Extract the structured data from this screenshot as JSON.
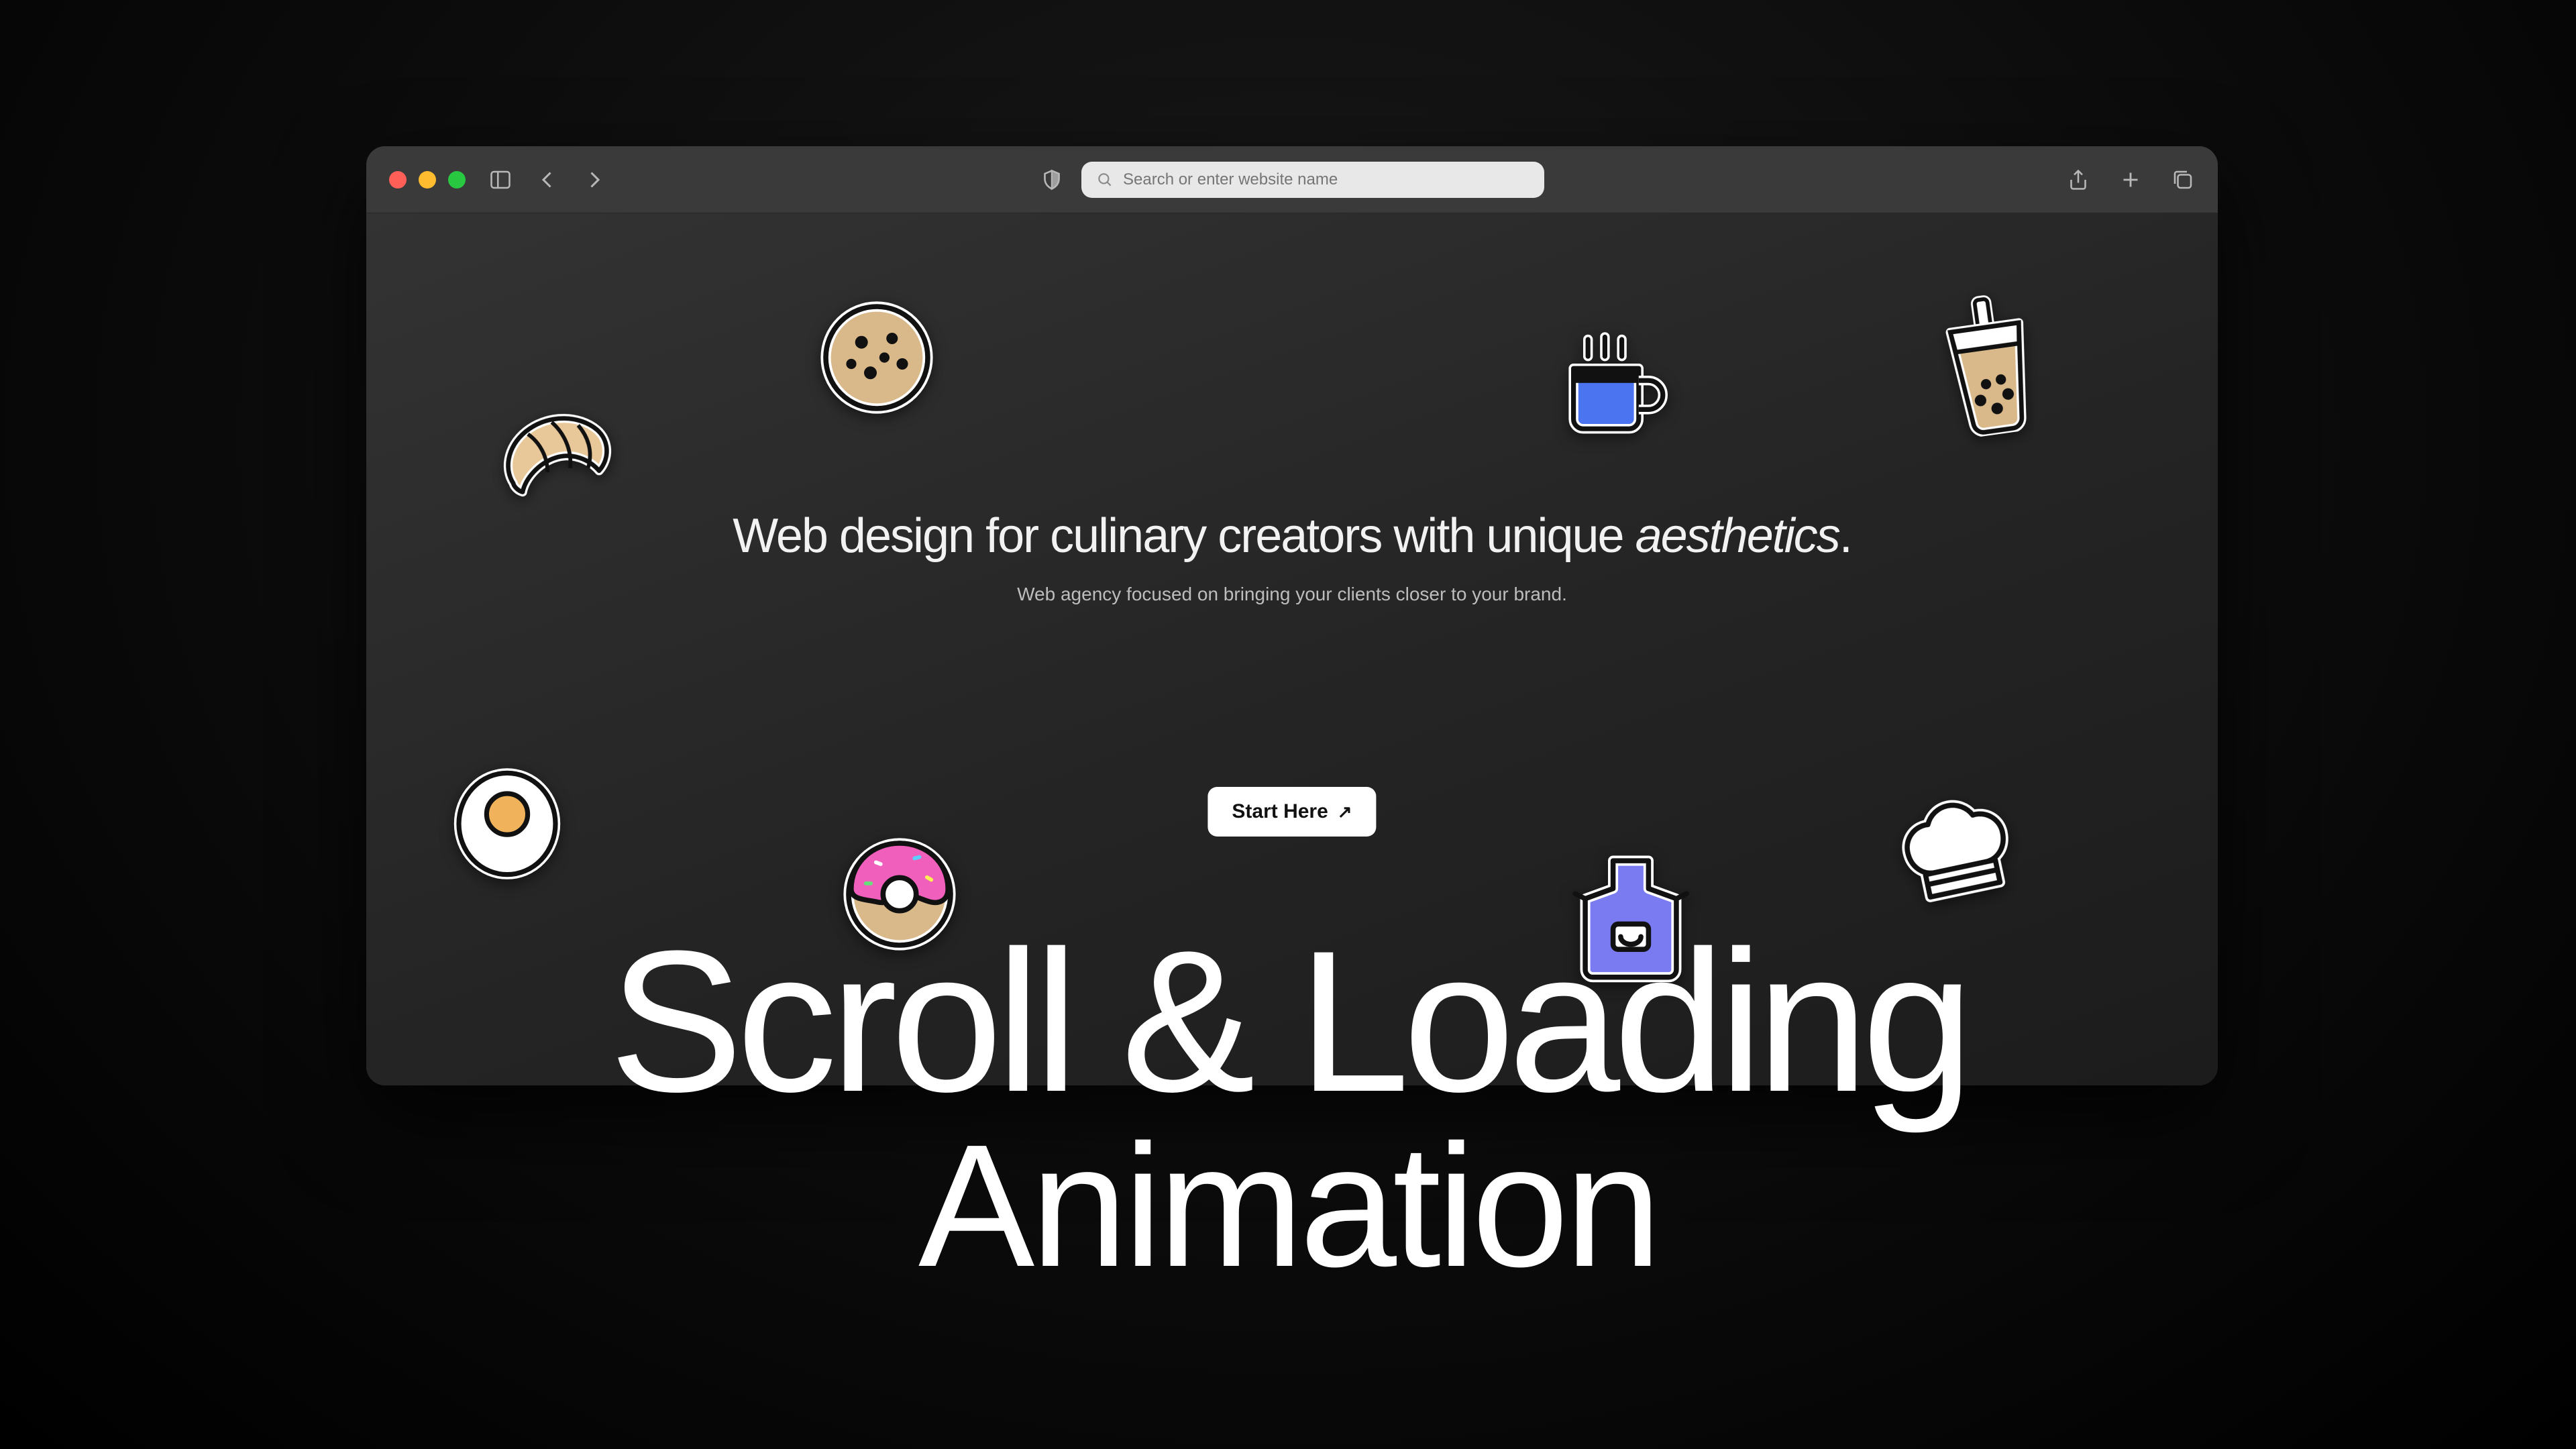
{
  "browser": {
    "address_placeholder": "Search or enter website name"
  },
  "hero": {
    "headline_part1": "Web design for culinary creators  with unique ",
    "headline_em": "aesthetics",
    "headline_suffix": ".",
    "subheading": "Web agency focused on bringing your clients closer to your brand."
  },
  "cta": {
    "label": "Start Here",
    "arrow": "↗"
  },
  "stickers": {
    "croissant": "croissant-icon",
    "cookie": "cookie-icon",
    "coffee": "coffee-mug-icon",
    "boba": "boba-tea-icon",
    "egg": "fried-egg-icon",
    "donut": "donut-icon",
    "apron": "apron-icon",
    "chefhat": "chef-hat-icon"
  },
  "overlay": {
    "line1": "Scroll & Loading",
    "line2": "Animation"
  }
}
